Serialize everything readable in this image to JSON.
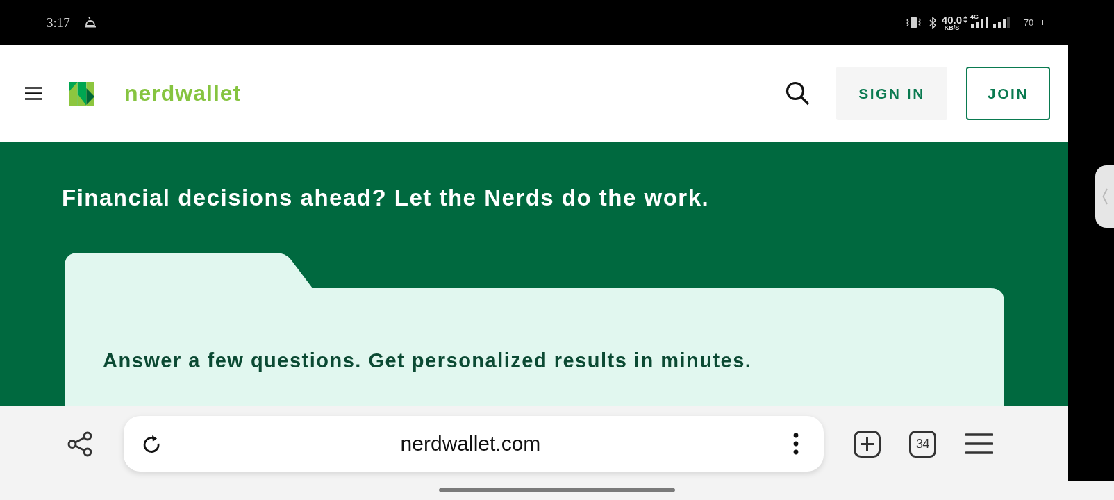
{
  "status_bar": {
    "time": "3:17",
    "network_speed": "40.0",
    "network_speed_unit": "KB/S",
    "network_type": "4G",
    "battery": "70"
  },
  "header": {
    "logo_text": "nerdwallet",
    "buttons": [
      {
        "label": "SIGN IN",
        "kind": "filled"
      },
      {
        "label": "JOIN",
        "kind": "outlined"
      }
    ]
  },
  "hero": {
    "headline": "Financial decisions ahead? Let the Nerds do the work.",
    "card_text": "Answer a few questions. Get personalized results in minutes."
  },
  "browser_bar": {
    "url": "nerdwallet.com",
    "tab_count": "34"
  }
}
